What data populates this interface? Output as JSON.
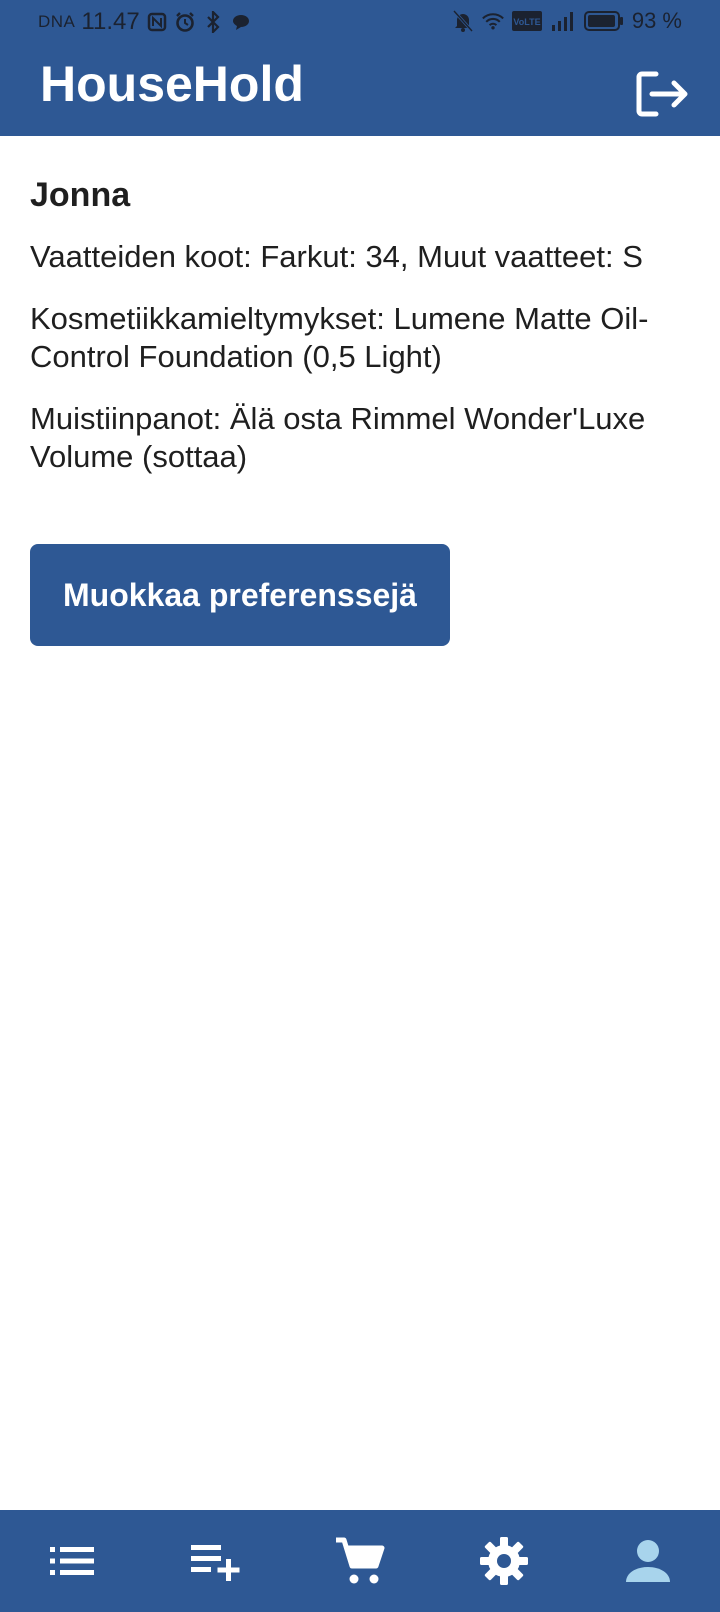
{
  "status_bar": {
    "carrier": "DNA",
    "time": "11.47",
    "battery_percent": "93 %",
    "network_badge": "VoLTE",
    "left_icons": [
      "nfc-icon",
      "alarm-icon",
      "bluetooth-icon",
      "chat-bubble-icon"
    ],
    "right_icons": [
      "mute-notifications-icon",
      "wifi-icon",
      "volte-icon",
      "cellular-signal-icon",
      "battery-icon"
    ]
  },
  "header": {
    "title": "HouseHold",
    "logout_icon": "logout-icon"
  },
  "profile": {
    "name": "Jonna",
    "clothing_sizes": "Vaatteiden koot: Farkut: 34, Muut vaatteet: S",
    "cosmetics_preferences": "Kosmetiikkamieltymykset: Lumene Matte Oil-Control Foundation (0,5 Light)",
    "notes": "Muistiinpanot: Älä osta Rimmel Wonder'Luxe Volume (sottaa)",
    "edit_button_label": "Muokkaa preferenssejä"
  },
  "bottom_nav": {
    "items": [
      {
        "icon": "list-icon"
      },
      {
        "icon": "playlist-add-icon"
      },
      {
        "icon": "shopping-cart-icon"
      },
      {
        "icon": "settings-gear-icon"
      },
      {
        "icon": "person-icon",
        "active": true
      }
    ]
  },
  "colors": {
    "primary": "#2e5894",
    "text": "#1f1f1f",
    "active_nav_icon": "#a8d4ec",
    "nav_icon": "#ffffff"
  }
}
